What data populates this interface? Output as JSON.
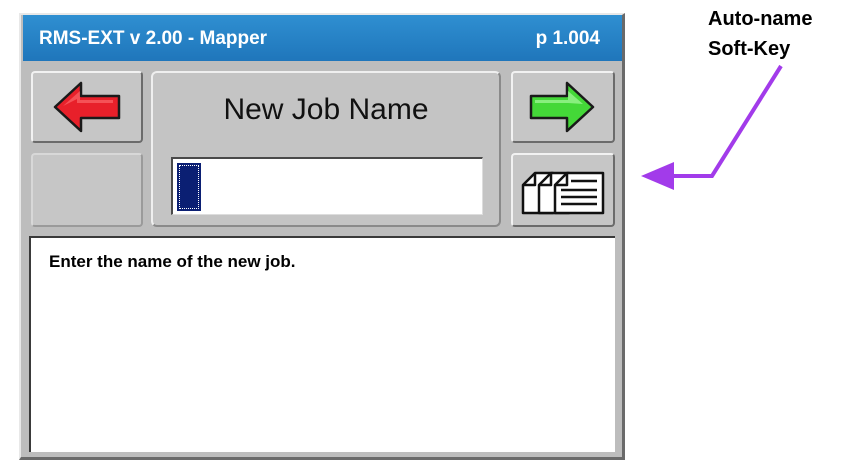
{
  "window": {
    "title": "RMS-EXT v 2.00 - Mapper",
    "page": "p 1.004"
  },
  "screen": {
    "heading": "New Job Name",
    "name_field_value": "",
    "message": "Enter the name of the new job."
  },
  "softkeys": {
    "back": "left-arrow-icon",
    "next": "right-arrow-icon",
    "auto_name": "auto-name-icon"
  },
  "annotation": {
    "line1": "Auto-name",
    "line2": "Soft-Key"
  },
  "colors": {
    "title_bar": "#2a86c9",
    "back_arrow": "#e8202a",
    "next_arrow": "#44d838",
    "caret": "#0b1f73",
    "callout_arrow": "#a23bea"
  }
}
